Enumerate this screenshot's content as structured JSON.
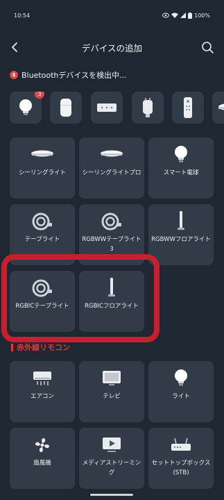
{
  "status_bar": {
    "time": "10:54",
    "battery": "100%"
  },
  "header": {
    "title": "デバイスの追加"
  },
  "bluetooth": {
    "scan_text": "Bluetoothデバイスを検出中...",
    "scan_badge": "$",
    "bulb_count": "3"
  },
  "devices": [
    {
      "label": "シーリングライト",
      "icon": "ceiling-light-icon"
    },
    {
      "label": "シーリングライトプロ",
      "icon": "ceiling-light-icon"
    },
    {
      "label": "スマート電球",
      "icon": "bulb-icon"
    },
    {
      "label": "テープライト",
      "icon": "tape-light-icon"
    },
    {
      "label": "RGBWWテープライト3",
      "icon": "tape-light-icon"
    },
    {
      "label": "RGBWWフロアライト",
      "icon": "floor-light-icon"
    },
    {
      "label": "RGBICテープライト",
      "icon": "tape-light-icon"
    },
    {
      "label": "RGBICフロアライト",
      "icon": "floor-light-icon"
    }
  ],
  "ir_section": {
    "title": "赤外線リモコン"
  },
  "ir_devices": [
    {
      "label": "エアコン",
      "icon": "air-conditioner-icon"
    },
    {
      "label": "テレビ",
      "icon": "tv-icon"
    },
    {
      "label": "ライト",
      "icon": "bulb-icon"
    },
    {
      "label": "扇風機",
      "icon": "fan-icon"
    },
    {
      "label": "メディアストリーミング",
      "icon": "media-streaming-icon"
    },
    {
      "label": "セットトップボックス(STB)",
      "icon": "set-top-box-icon"
    }
  ],
  "colors": {
    "background": "#1f2733",
    "tile": "#323b48",
    "highlight": "#c6202d",
    "accent_red": "#e03a3a"
  }
}
